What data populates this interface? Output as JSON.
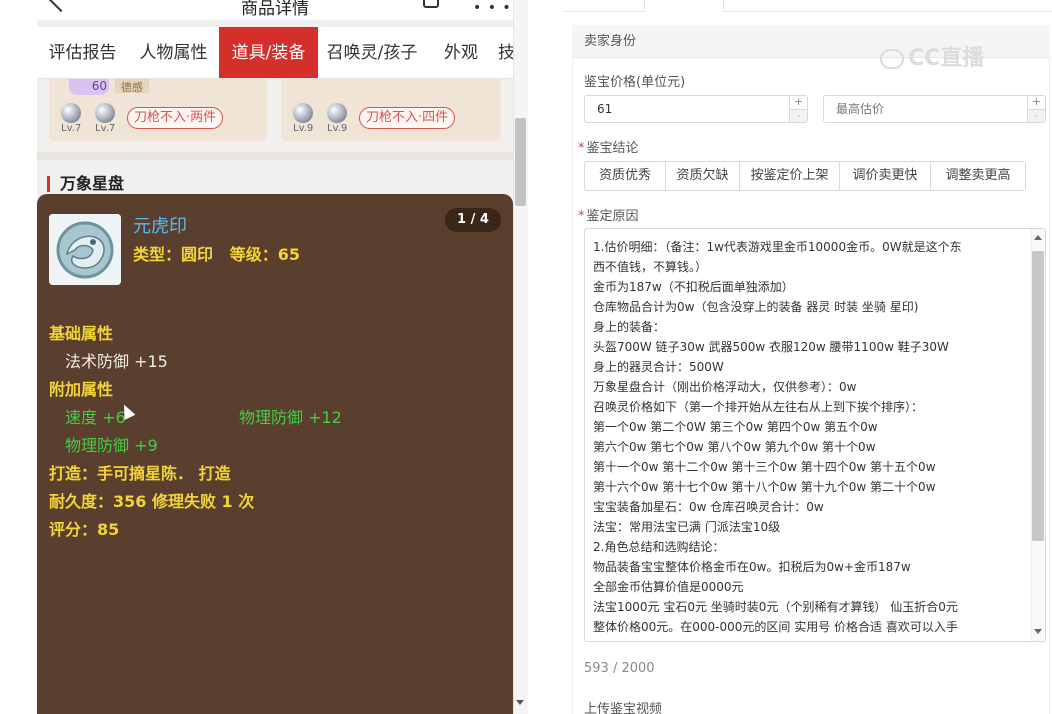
{
  "phone": {
    "title": "商品详情",
    "more": "• • •",
    "tabs": [
      "评估报告",
      "人物属性",
      "道具/装备",
      "召唤灵/孩子",
      "外观",
      "技"
    ],
    "active_tab": 2,
    "equip_cards": [
      {
        "badge": "60",
        "tag": "德感",
        "lv1": "Lv.7",
        "lv2": "Lv.7",
        "pill": "刀枪不入·两件"
      },
      {
        "tag": "",
        "lv1": "Lv.9",
        "lv2": "Lv.9",
        "pill": "刀枪不入·四件"
      }
    ],
    "section_title": "万象星盘",
    "item": {
      "name": "元虎印",
      "type_line": "类型：圆印   等级：65",
      "counter": "1 / 4",
      "base_header": "基础属性",
      "base_attr": "法术防御 +15",
      "extra_header": "附加属性",
      "extra_attr1": "速度 +6",
      "extra_attr2": "物理防御 +12",
      "extra_attr3": "物理防御 +9",
      "forge": "打造：手可摘星陈．  打造",
      "durability": "耐久度：356 修理失败 1 次",
      "score": "评分：85"
    }
  },
  "form": {
    "seller_header": "卖家身份",
    "watermark": "CC直播",
    "price_label": "鉴宝价格(单位元)",
    "price_value": "61",
    "max_price_placeholder": "最高估价",
    "conclusion_label": "鉴宝结论",
    "conclusion_options": [
      "资质优秀",
      "资质欠缺",
      "按鉴定价上架",
      "调价卖更快",
      "调整卖更高"
    ],
    "reason_label": "鉴定原因",
    "reason_lines": [
      "1.估价明细：（备注：1w代表游戏里金币10000金币。0W就是这个东",
      "西不值钱，不算钱。）",
      "金币为187w（不扣税后面单独添加）",
      "仓库物品合计为0w（包含没穿上的装备 器灵 时装 坐骑 星印)",
      "身上的装备：",
      "头盔700W 链子30w 武器500w 衣服120w 腰带1100w 鞋子30W",
      "身上的器灵合计：500W",
      "万象星盘合计（刚出价格浮动大，仅供参考）：0w",
      "召唤灵价格如下（第一个排开始从左往右从上到下挨个排序）：",
      "第一个0w 第二个0W  第三个0w  第四个0w  第五个0w",
      "第六个0w  第七个0w  第八个0w   第九个0w  第十个0w",
      "第十一个0w 第十二个0w 第十三个0w 第十四个0w  第十五个0w",
      "第十六个0w 第十七个0w 第十八个0w 第十九个0w  第二十个0w",
      "宝宝装备加星石：0w     仓库召唤灵合计：0w",
      "法宝：常用法宝已满 门派法宝10级",
      "2.角色总结和选购结论：",
      "物品装备宝宝整体价格金币在0w。扣税后为0w+金币187w",
      "全部金币估算价值是0000元",
      "法宝1000元 宝石0元  坐骑时装0元（个别稀有才算钱） 仙玉折合0元",
      "整体价格00元。在000-000元的区间 实用号 价格合适 喜欢可以入手"
    ],
    "char_count": "593 / 2000",
    "upload_video_label": "上传鉴宝视频"
  },
  "colors": {
    "active_tab": "#d42f2a",
    "popup_bg": "#5a3f2e",
    "item_name": "#5ab8f0",
    "attr_yellow": "#f2d338",
    "attr_green": "#44cc44"
  }
}
